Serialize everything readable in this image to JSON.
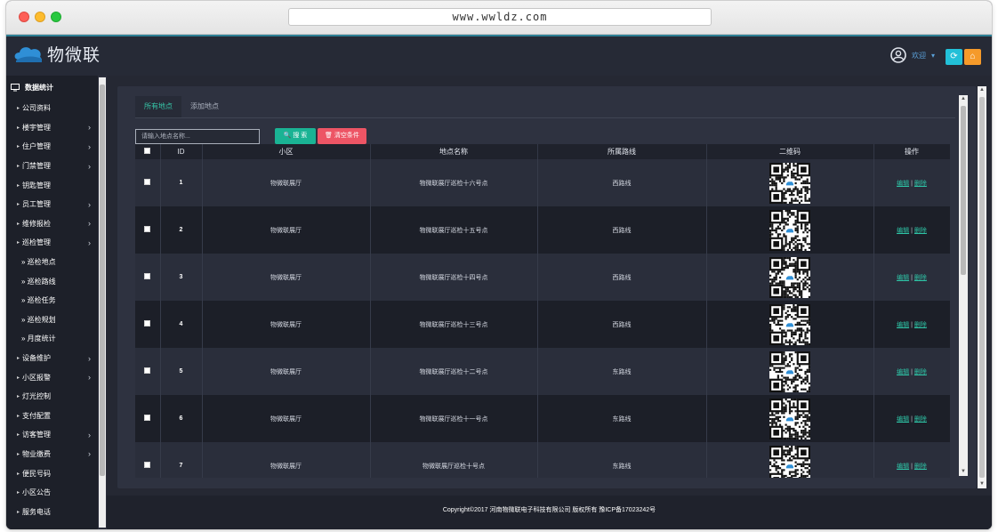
{
  "browser": {
    "url": "www.wwldz.com"
  },
  "header": {
    "logo_text": "物微联",
    "welcome": "欢迎",
    "welcome_caret": "▾",
    "refresh_icon": "⟳",
    "home_icon": "⌂"
  },
  "sidebar": {
    "title": "数据统计",
    "items": [
      {
        "label": "公司资料",
        "chevron": false
      },
      {
        "label": "楼宇管理",
        "chevron": true
      },
      {
        "label": "住户管理",
        "chevron": true
      },
      {
        "label": "门禁管理",
        "chevron": true
      },
      {
        "label": "钥匙管理",
        "chevron": false
      },
      {
        "label": "员工管理",
        "chevron": true
      },
      {
        "label": "维修报检",
        "chevron": true
      },
      {
        "label": "巡检管理",
        "chevron": true
      }
    ],
    "sub_items": [
      "» 巡检地点",
      "» 巡检路线",
      "» 巡检任务",
      "» 巡检规划",
      "» 月度统计"
    ],
    "items_after": [
      {
        "label": "设备维护",
        "chevron": true
      },
      {
        "label": "小区报警",
        "chevron": true
      },
      {
        "label": "灯光控制",
        "chevron": false
      },
      {
        "label": "支付配置",
        "chevron": false
      },
      {
        "label": "访客管理",
        "chevron": true
      },
      {
        "label": "物业缴费",
        "chevron": true
      },
      {
        "label": "便民号码",
        "chevron": false
      },
      {
        "label": "小区公告",
        "chevron": false
      },
      {
        "label": "服务电话",
        "chevron": false
      }
    ]
  },
  "tabs": [
    "所有地点",
    "添加地点"
  ],
  "search": {
    "placeholder": "请输入地点名称...",
    "search_label": "搜 索",
    "clear_label": "清空条件"
  },
  "table": {
    "columns": [
      "",
      "ID",
      "小区",
      "地点名称",
      "所属路线",
      "二维码",
      "操作"
    ],
    "rows": [
      {
        "id": "1",
        "community": "物微联展厅",
        "place": "物微联展厅巡检十六号点",
        "route": "西路线"
      },
      {
        "id": "2",
        "community": "物微联展厅",
        "place": "物微联展厅巡检十五号点",
        "route": "西路线"
      },
      {
        "id": "3",
        "community": "物微联展厅",
        "place": "物微联展厅巡检十四号点",
        "route": "西路线"
      },
      {
        "id": "4",
        "community": "物微联展厅",
        "place": "物微联展厅巡检十三号点",
        "route": "西路线"
      },
      {
        "id": "5",
        "community": "物微联展厅",
        "place": "物微联展厅巡检十二号点",
        "route": "东路线"
      },
      {
        "id": "6",
        "community": "物微联展厅",
        "place": "物微联展厅巡检十一号点",
        "route": "东路线"
      },
      {
        "id": "7",
        "community": "物微联展厅",
        "place": "物微联展厅巡检十号点",
        "route": "东路线"
      }
    ],
    "edit_label": "编辑",
    "sep": "|",
    "delete_label": "删除"
  },
  "footer": {
    "text": "Copyright©2017 河南物微联电子科技有限公司 版权所有 豫ICP备17023242号"
  },
  "colors": {
    "accent": "#1ab394",
    "danger": "#ed5565",
    "link": "#2ec4a6",
    "bg": "#252833"
  }
}
